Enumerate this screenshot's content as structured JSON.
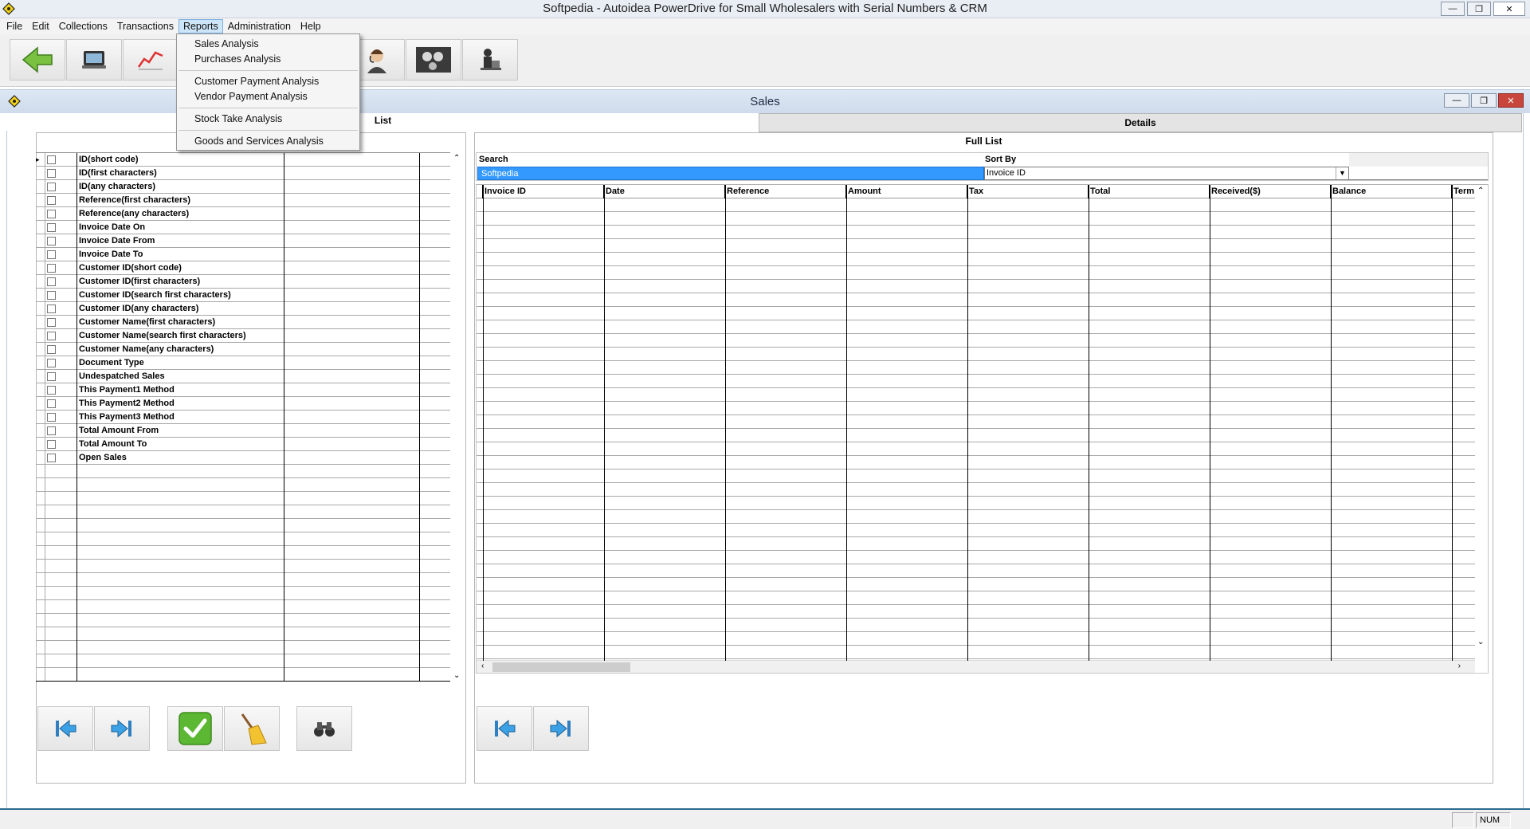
{
  "app": {
    "title": "Softpedia - Autoidea PowerDrive for Small Wholesalers with Serial Numbers & CRM",
    "window_buttons": {
      "minimize": "—",
      "restore": "❐",
      "close": "✕"
    }
  },
  "menu": [
    "File",
    "Edit",
    "Collections",
    "Transactions",
    "Reports",
    "Administration",
    "Help"
  ],
  "reports_menu": {
    "items": [
      {
        "label": "Sales Analysis",
        "accel": "S"
      },
      {
        "label": "Purchases Analysis",
        "accel": "P"
      },
      {
        "label": "Customer Payment Analysis",
        "accel": "C"
      },
      {
        "label": "Vendor Payment Analysis",
        "accel": "V"
      },
      {
        "label": "Stock Take Analysis",
        "accel": "S"
      },
      {
        "label": "Goods and Services Analysis",
        "accel": "G"
      }
    ]
  },
  "toolbar": {
    "icons": [
      "back-arrow-icon",
      "computer-icon",
      "chart-icon",
      "customer-support-icon",
      "film-reel-icon",
      "stock-person-icon"
    ]
  },
  "window": {
    "title": "Sales"
  },
  "tabs": {
    "list": "List",
    "details": "Details"
  },
  "filters": {
    "rows": [
      "ID(short code)",
      "ID(first characters)",
      "ID(any characters)",
      "Reference(first characters)",
      "Reference(any characters)",
      "Invoice Date On",
      "Invoice Date From",
      "Invoice Date To",
      "Customer ID(short code)",
      "Customer ID(first characters)",
      "Customer ID(search first characters)",
      "Customer ID(any characters)",
      "Customer Name(first characters)",
      "Customer Name(search first characters)",
      "Customer Name(any characters)",
      "Document Type",
      "Undespatched Sales",
      "This Payment1 Method",
      "This Payment2 Method",
      "This Payment3 Method",
      "Total Amount From",
      "Total Amount To",
      "Open Sales"
    ]
  },
  "full_list": {
    "label": "Full List",
    "search_label": "Search",
    "search_value": "Softpedia",
    "sort_label": "Sort By",
    "sort_value": "Invoice ID",
    "columns": [
      "Invoice ID",
      "Date",
      "Reference",
      "Amount",
      "Tax",
      "Total",
      "Received($)",
      "Balance",
      "Term"
    ]
  },
  "status": {
    "num": "NUM"
  },
  "colors": {
    "search_highlight": "#3399ff",
    "close_red": "#c9463d",
    "status_border": "#2a6b8f"
  }
}
